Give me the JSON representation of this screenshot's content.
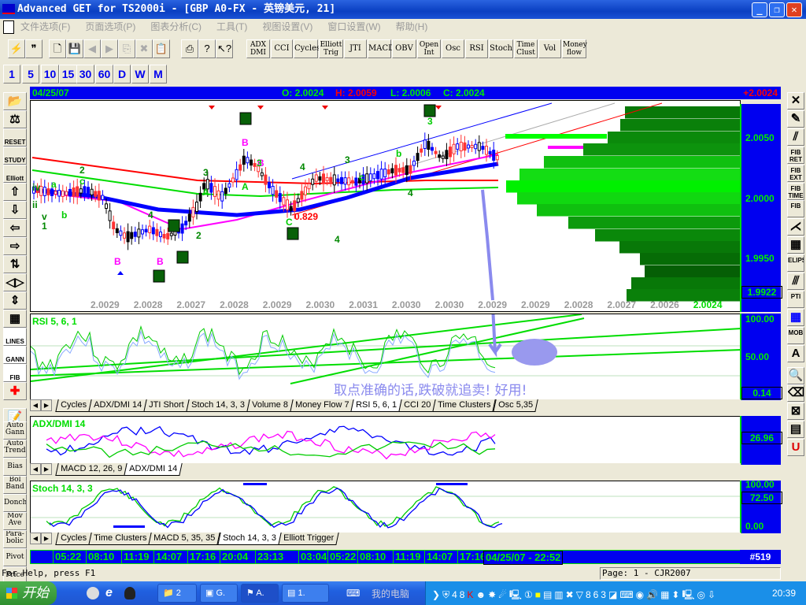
{
  "window": {
    "title": "Advanced GET for TS2000i - [GBP A0-FX - 英镑美元, 21]",
    "min": "_",
    "restore": "❐",
    "close": "✕"
  },
  "menu": [
    "文件选项(F)",
    "页面选项(P)",
    "图表分析(C)",
    "工具(T)",
    "视图设置(V)",
    "窗口设置(W)",
    "帮助(H)"
  ],
  "toolbar": {
    "icons": [
      "get-logo",
      "quote",
      "new-doc",
      "save",
      "back",
      "forward",
      "copy",
      "delete",
      "paste",
      "print",
      "help",
      "context-help"
    ],
    "indicators": [
      [
        "ADX",
        "DMI"
      ],
      [
        "CCI"
      ],
      [
        "Cycles"
      ],
      [
        "Elliott",
        "Trig"
      ],
      [
        "JTI"
      ],
      [
        "MACD"
      ],
      [
        "OBV"
      ],
      [
        "Open",
        "Int"
      ],
      [
        "Osc"
      ],
      [
        "RSI"
      ],
      [
        "Stoch"
      ],
      [
        "Time",
        "Clust"
      ],
      [
        "Vol"
      ],
      [
        "Money",
        "flow"
      ]
    ],
    "periods": [
      "1",
      "5",
      "10",
      "15",
      "30",
      "60",
      "D",
      "W",
      "M"
    ]
  },
  "left_tools": [
    "open",
    "scales",
    "RESET",
    "STUDY",
    "Elliott",
    "up",
    "down",
    "left",
    "right",
    "compress",
    "expand-h",
    "expand-v",
    "grid",
    "LINES",
    "GANN",
    "FIB",
    "crosshair",
    "properties"
  ],
  "left_tools2": [
    [
      "Auto",
      "Gann"
    ],
    [
      "Auto",
      "Trend"
    ],
    [
      "Bias"
    ],
    [
      "Bol",
      "Band"
    ],
    [
      "Donch"
    ],
    [
      "Mov",
      "Ave"
    ],
    [
      "Para-",
      "bolic"
    ],
    [
      "Pivot"
    ],
    [
      "Price"
    ]
  ],
  "right_tools": [
    "X",
    "pencil",
    "parallel-lines",
    "FIB RET",
    "FIB EXT",
    "FIB TIME",
    "FIB",
    "fan",
    "grid",
    "ELIPS",
    "channels",
    "PTI",
    "table",
    "MOB",
    "A",
    "zoom",
    "eraser",
    "fit",
    "pages",
    "U"
  ],
  "chart": {
    "date": "04/25/07",
    "open": "O: 2.0024",
    "high": "H: 2.0059",
    "low": "L: 2.0006",
    "close": "C: 2.0024",
    "change": "+2.0024",
    "price_axis": [
      "2.0050",
      "2.0000",
      "1.9950"
    ],
    "current": "1.9922",
    "x_labels": [
      "2.0029",
      "2.0028",
      "2.0027",
      "2.0028",
      "2.0029",
      "2.0030",
      "2.0031",
      "2.0030",
      "2.0030",
      "2.0029",
      "2.0029",
      "2.0028",
      "2.0027",
      "2.0026",
      "2.0024"
    ],
    "wave_labels": [
      "iv",
      "a",
      "ii",
      "v",
      "1",
      "b",
      "2",
      "c",
      "B",
      "4",
      "B",
      "5",
      "1",
      "2",
      "3",
      "B",
      "B",
      "A",
      "3",
      "2",
      "A",
      "4",
      "C",
      "0.829",
      "3",
      "b",
      "4",
      "c",
      "5",
      "3",
      "4",
      "1",
      "2",
      "5"
    ],
    "annotation": "取点准确的话,跌破就追卖!  好用!"
  },
  "rsi": {
    "title": "RSI 5, 6, 1",
    "axis": [
      "100.00",
      "50.00"
    ],
    "value": "0.14",
    "tabs": [
      "Cycles",
      "ADX/DMI 14",
      "JTI Short",
      "Stoch 14, 3, 3",
      "Volume 8",
      "Money Flow 7",
      "RSI 5, 6, 1",
      "CCI 20",
      "Time Clusters",
      "Osc 5,35"
    ],
    "active": 6
  },
  "adx": {
    "title": "ADX/DMI 14",
    "value": "26.96",
    "tabs": [
      "MACD 12, 26, 9",
      "ADX/DMI 14"
    ],
    "active": 1
  },
  "stoch": {
    "title": "Stoch 14, 3, 3",
    "axis": [
      "100.00",
      "0.00"
    ],
    "value": "72.50",
    "tabs": [
      "Cycles",
      "Time Clusters",
      "MACD 5, 35, 35",
      "Stoch 14, 3, 3",
      "Elliott Trigger"
    ],
    "active": 3
  },
  "timebar": {
    "labels": [
      "05:22",
      "08:10",
      "11:19",
      "14:07",
      "17:16",
      "20:04",
      "23:13",
      "03:04",
      "05:22",
      "08:10",
      "11:19",
      "14:07",
      "17:16"
    ],
    "current": "04/25/07 - 22:52",
    "bars": "#519"
  },
  "status": {
    "help": "For Help, press F1",
    "page": "Page: 1 - CJR2007"
  },
  "taskbar": {
    "start": "开始",
    "tasks": [
      "2",
      "G.",
      "A.",
      "1."
    ],
    "desk": "我的电脑",
    "clock": "20:39"
  }
}
